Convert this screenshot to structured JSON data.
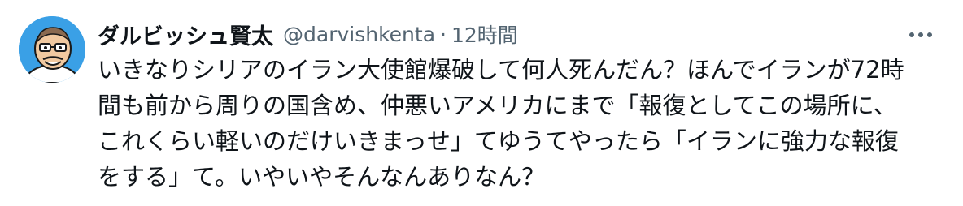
{
  "author": {
    "display_name": "ダルビッシュ賢太",
    "handle": "@darvishkenta",
    "separator": "·",
    "timestamp": "12時間"
  },
  "icons": {
    "avatar": "cartoon-face-avatar",
    "more": "more-options-icon"
  },
  "colors": {
    "text_primary": "#0f1419",
    "text_secondary": "#536471",
    "avatar_bg": "#3aa0e6"
  },
  "tweet": {
    "lines": [
      "いきなりシリアのイラン大使館爆破して何人死んだん？ほんでイランが72時",
      "間も前から周りの国含め、仲悪いアメリカにまで「報復としてこの場所に、",
      "これくらい軽いのだけいきまっせ」てゆうてやったら「イランに強力な報復",
      "をする」て。いやいやそんなんありなん？"
    ]
  }
}
